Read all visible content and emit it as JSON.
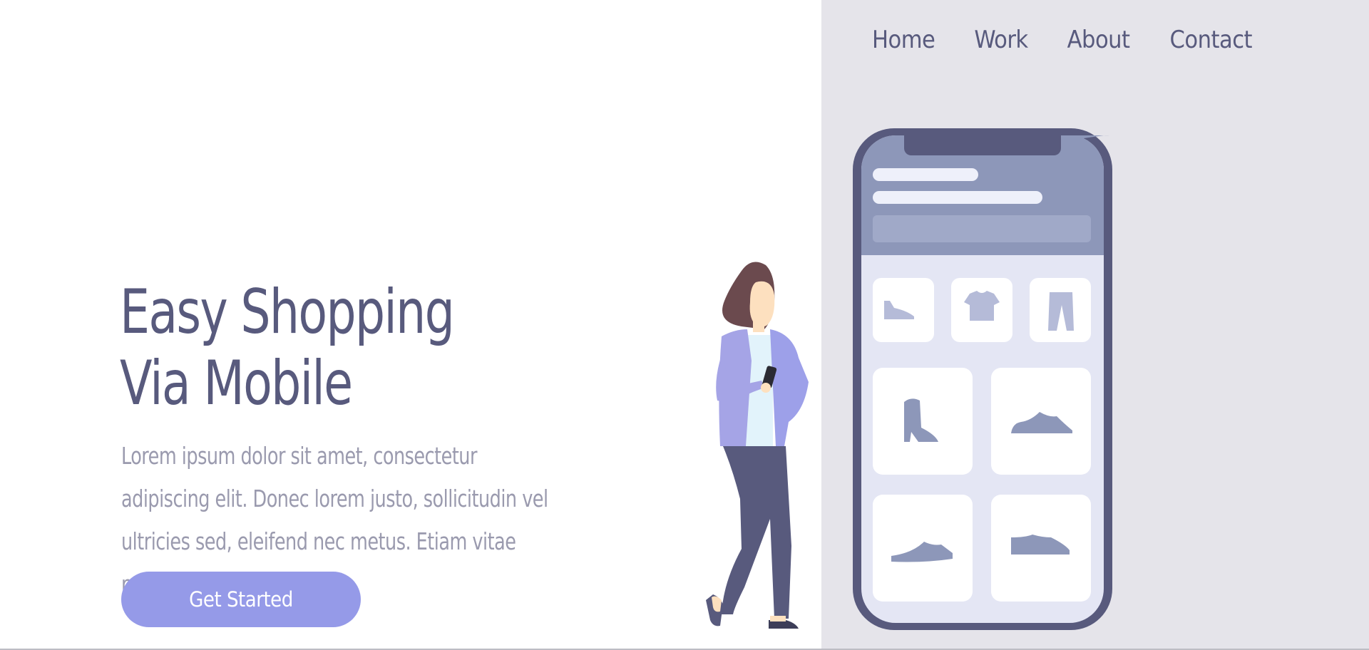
{
  "nav": {
    "items": [
      {
        "label": "Home"
      },
      {
        "label": "Work"
      },
      {
        "label": "About"
      },
      {
        "label": "Contact"
      }
    ]
  },
  "hero": {
    "title_line1": "Easy Shopping",
    "title_line2": "Via Mobile",
    "body": "Lorem ipsum dolor sit amet, consectetur adipiscing elit. Donec lorem justo, sollicitudin vel ultricies sed, eleifend nec metus. Etiam vitae pellentesque dolor.",
    "cta_label": "Get Started"
  },
  "colors": {
    "primary_text": "#585a7d",
    "muted_text": "#9a9aae",
    "accent": "#959ae8",
    "panel_bg": "#e5e4ea"
  },
  "illustration": {
    "subject": "woman-holding-phone",
    "phone_products": [
      "shoe-icon",
      "tshirt-icon",
      "pants-icon",
      "boot-icon",
      "sneaker-icon",
      "sneaker-icon",
      "sneaker-icon"
    ]
  }
}
